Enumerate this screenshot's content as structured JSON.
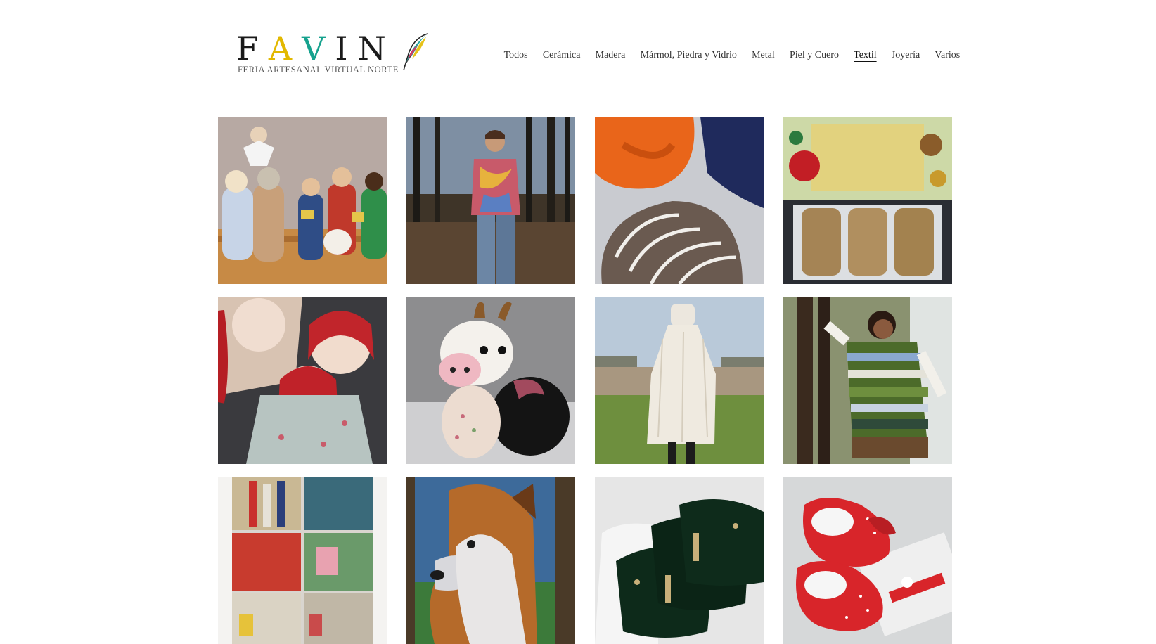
{
  "brand": {
    "wordmark": [
      "F",
      "A",
      "V",
      "I",
      "N"
    ],
    "wordmark_colors": [
      "#1a1a1a",
      "#e2b800",
      "#16a28e",
      "#1a1a1a",
      "#1a1a1a"
    ],
    "tagline": "FERIA ARTESANAL VIRTUAL NORTE",
    "logo_icon": "feather-icon"
  },
  "nav": {
    "items": [
      {
        "label": "Todos",
        "active": false
      },
      {
        "label": "Cerámica",
        "active": false
      },
      {
        "label": "Madera",
        "active": false
      },
      {
        "label": "Mármol, Piedra y Vidrio",
        "active": false
      },
      {
        "label": "Metal",
        "active": false
      },
      {
        "label": "Piel y Cuero",
        "active": false
      },
      {
        "label": "Textil",
        "active": true
      },
      {
        "label": "Joyería",
        "active": false
      },
      {
        "label": "Varios",
        "active": false
      }
    ]
  },
  "gallery": {
    "tiles": [
      {
        "subject": "crochet-nativity-dolls"
      },
      {
        "subject": "tie-dye-shirt-boy-in-forest"
      },
      {
        "subject": "knitted-scarves"
      },
      {
        "subject": "christmas-breads"
      },
      {
        "subject": "red-haired-cloth-dolls"
      },
      {
        "subject": "plush-cow"
      },
      {
        "subject": "white-knit-poncho"
      },
      {
        "subject": "striped-poncho-woman"
      },
      {
        "subject": "painted-bottles-and-jars"
      },
      {
        "subject": "dog-tapestry"
      },
      {
        "subject": "black-face-masks"
      },
      {
        "subject": "red-polka-dot-baby-shoes"
      }
    ]
  }
}
